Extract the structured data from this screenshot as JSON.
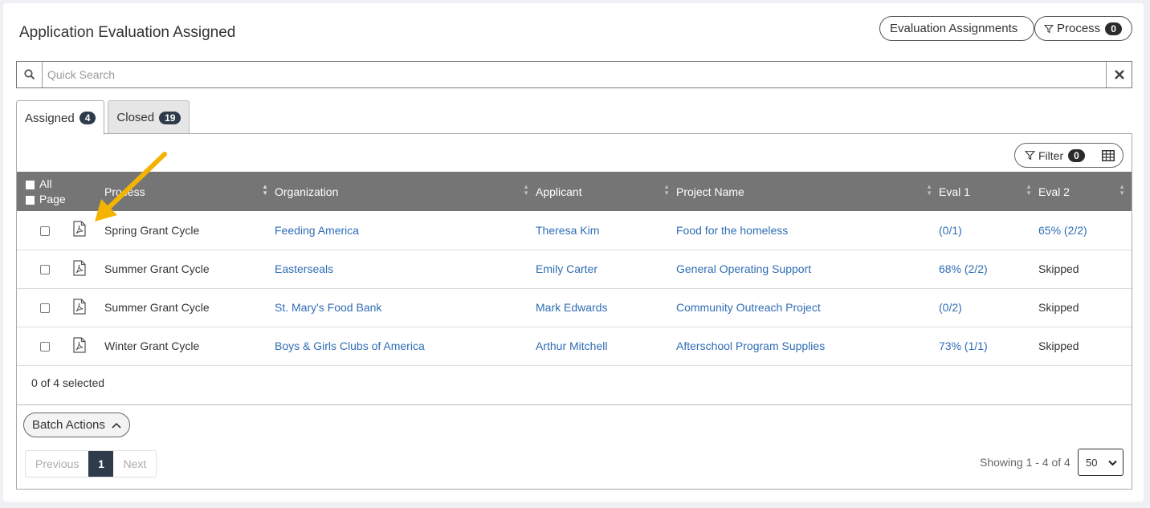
{
  "header": {
    "title": "Application Evaluation Assigned",
    "eval_assignments_label": "Evaluation Assignments",
    "process_label": "Process",
    "process_count": "0"
  },
  "search": {
    "placeholder": "Quick Search",
    "value": ""
  },
  "tabs": [
    {
      "label": "Assigned",
      "count": "4",
      "active": true
    },
    {
      "label": "Closed",
      "count": "19",
      "active": false
    }
  ],
  "toolbar": {
    "filter_label": "Filter",
    "filter_count": "0"
  },
  "table": {
    "select_all_label": "All",
    "select_page_label": "Page",
    "columns": [
      "Process",
      "Organization",
      "Applicant",
      "Project Name",
      "Eval 1",
      "Eval 2"
    ],
    "rows": [
      {
        "process": "Spring Grant Cycle",
        "organization": "Feeding America",
        "applicant": "Theresa Kim",
        "project": "Food for the homeless",
        "eval1": "(0/1)",
        "eval2": "65% (2/2)"
      },
      {
        "process": "Summer Grant Cycle",
        "organization": "Easterseals",
        "applicant": "Emily Carter",
        "project": "General Operating Support",
        "eval1": "68% (2/2)",
        "eval2": "Skipped"
      },
      {
        "process": "Summer Grant Cycle",
        "organization": "St. Mary's Food Bank",
        "applicant": "Mark Edwards",
        "project": "Community Outreach Project",
        "eval1": "(0/2)",
        "eval2": "Skipped"
      },
      {
        "process": "Winter Grant Cycle",
        "organization": "Boys & Girls Clubs of America",
        "applicant": "Arthur Mitchell",
        "project": "Afterschool Program Supplies",
        "eval1": "73% (1/1)",
        "eval2": "Skipped"
      }
    ]
  },
  "selection_text": "0 of 4 selected",
  "batch_actions_label": "Batch Actions",
  "pagination": {
    "previous": "Previous",
    "current": "1",
    "next": "Next",
    "showing": "Showing 1 - 4 of 4",
    "page_size": "50"
  },
  "colors": {
    "link": "#2f6db5",
    "header_bg": "#757575",
    "badge": "#2d3b4a",
    "annotation_arrow": "#f2b400"
  }
}
